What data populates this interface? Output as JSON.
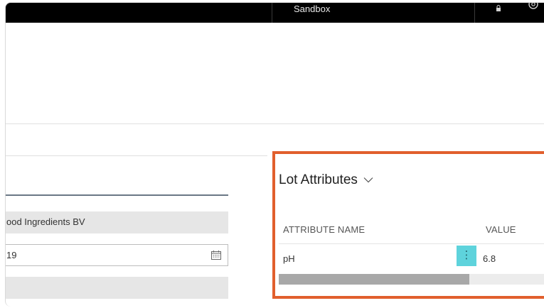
{
  "topbar": {
    "environment_label": "Sandbox"
  },
  "left_panel": {
    "fields": [
      {
        "value": "ood Ingredients BV"
      },
      {
        "value": "19"
      },
      {
        "value": ""
      }
    ]
  },
  "factbox": {
    "title": "Lot Attributes",
    "columns": [
      "ATTRIBUTE NAME",
      "VALUE"
    ],
    "rows": [
      {
        "attribute_name": "pH",
        "value": "6.8",
        "menu_glyph": "⋮"
      }
    ],
    "scroll_position_fraction": 0.72
  },
  "colors": {
    "topbar": "#000000",
    "highlight_border": "#e15f2d",
    "row_selector": "#5ed3dc",
    "readonly_field": "#e6e6e6"
  },
  "icons": [
    "lock-icon",
    "settings-icon",
    "calendar-icon",
    "chevron-down-icon"
  ]
}
